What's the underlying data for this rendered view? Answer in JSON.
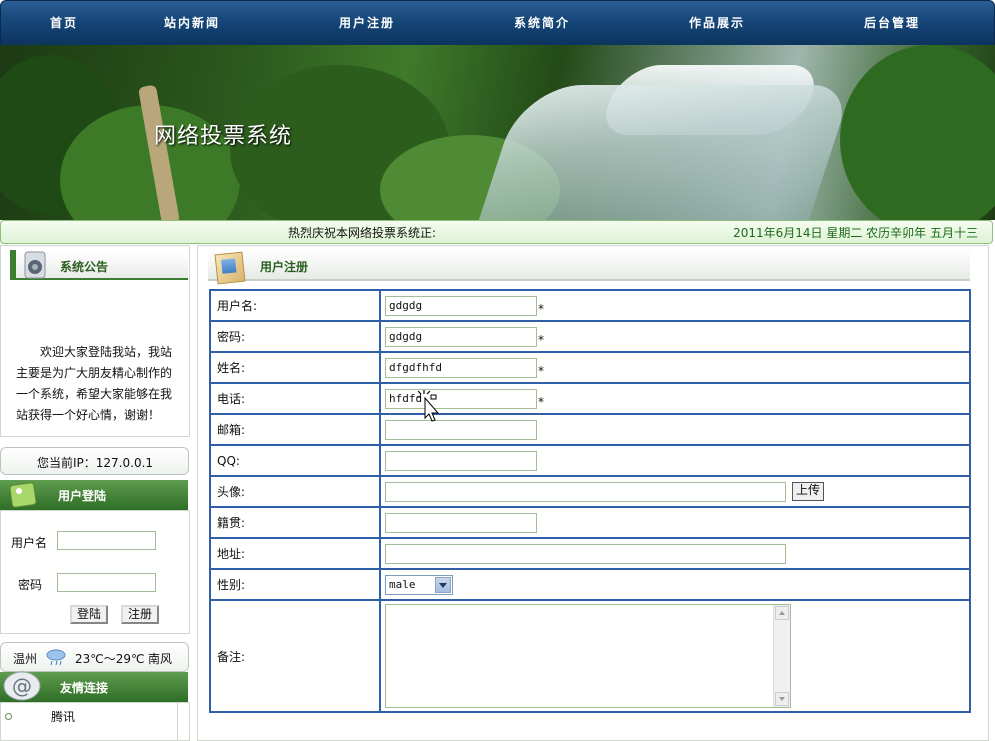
{
  "nav": {
    "items": [
      {
        "label": "首页"
      },
      {
        "label": "站内新闻"
      },
      {
        "label": "用户注册"
      },
      {
        "label": "系统简介"
      },
      {
        "label": "作品展示"
      },
      {
        "label": "后台管理"
      }
    ]
  },
  "banner": {
    "title": "网络投票系统"
  },
  "marquee": {
    "message": "热烈庆祝本网络投票系统正:",
    "date": "2011年6月14日 星期二 农历辛卯年 五月十三"
  },
  "sidebar": {
    "notice_title": "系统公告",
    "notice_text": "欢迎大家登陆我站，我站主要是为广大朋友精心制作的一个系统，希望大家能够在我站获得一个好心情，谢谢！",
    "ip_text": "您当前IP：127.0.0.1",
    "login": {
      "title": "用户登陆",
      "username_label": "用户名",
      "password_label": "密码",
      "login_button": "登陆",
      "register_button": "注册"
    },
    "weather": {
      "city": "温州",
      "temp": "23℃～29℃",
      "wind": "南风"
    },
    "links": {
      "title": "友情连接",
      "items": [
        {
          "label": "腾讯"
        }
      ]
    }
  },
  "register": {
    "title": "用户注册",
    "fields": {
      "username": {
        "label": "用户名:",
        "value": "gdgdg"
      },
      "password": {
        "label": "密码:",
        "value": "gdgdg"
      },
      "realname": {
        "label": "姓名:",
        "value": "dfgdfhfd"
      },
      "phone": {
        "label": "电话:",
        "value": "hfdfd"
      },
      "email": {
        "label": "邮箱:",
        "value": ""
      },
      "qq": {
        "label": "QQ:",
        "value": ""
      },
      "avatar": {
        "label": "头像:",
        "value": "",
        "button": "上传"
      },
      "hometown": {
        "label": "籍贯:",
        "value": ""
      },
      "address": {
        "label": "地址:",
        "value": ""
      },
      "gender": {
        "label": "性别:",
        "value": "male"
      },
      "remark": {
        "label": "备注:",
        "value": ""
      }
    },
    "required_mark": "*"
  },
  "colors": {
    "nav_bg": "#134273",
    "green_head": "#2f6e26",
    "table_border": "#2e5fa8",
    "date_text": "#1b6a1b"
  }
}
